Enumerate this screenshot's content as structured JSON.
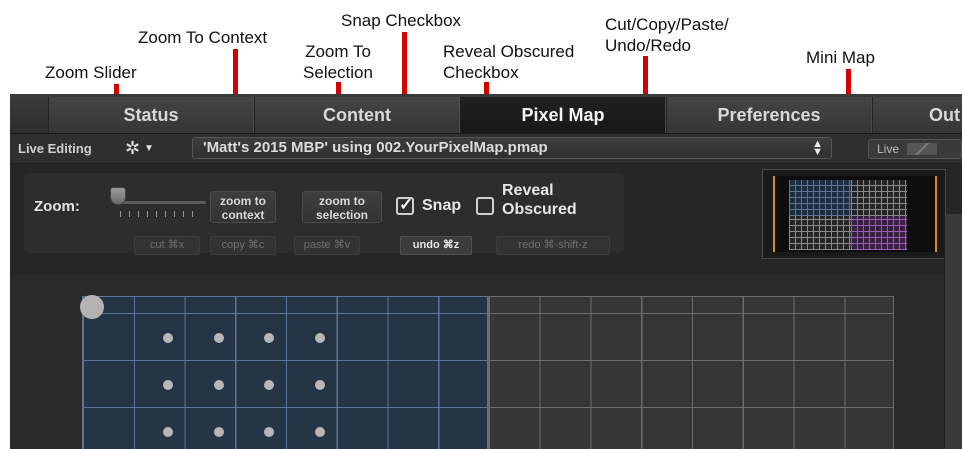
{
  "annotations": {
    "zoom_slider": "Zoom Slider",
    "zoom_to_context": "Zoom To Context",
    "zoom_to_selection_1": "Zoom To",
    "zoom_to_selection_2": "Selection",
    "snap_checkbox": "Snap Checkbox",
    "reveal_obscured_1": "Reveal Obscured",
    "reveal_obscured_2": "Checkbox",
    "cut_copy_paste_1": "Cut/Copy/Paste/",
    "cut_copy_paste_2": "Undo/Redo",
    "mini_map": "Mini Map"
  },
  "colors": {
    "annotation_line": "#d40000",
    "minimap_view": "#d98a1e"
  },
  "tabs": [
    {
      "label": "Status",
      "active": false
    },
    {
      "label": "Content",
      "active": false
    },
    {
      "label": "Pixel Map",
      "active": true
    },
    {
      "label": "Preferences",
      "active": false
    },
    {
      "label": "Out",
      "active": false
    }
  ],
  "edit_row": {
    "live_editing": "Live Editing",
    "gear_icon": "gear-icon",
    "pixel_map_selection": "'Matt's 2015 MBP' using 002.YourPixelMap.pmap",
    "live_label": "Live"
  },
  "toolbar": {
    "zoom_label": "Zoom:",
    "zoom_to_context_1": "zoom to",
    "zoom_to_context_2": "context",
    "zoom_to_selection_1": "zoom to",
    "zoom_to_selection_2": "selection",
    "snap_label": "Snap",
    "snap_checked": true,
    "reveal_1": "Reveal",
    "reveal_2": "Obscured",
    "reveal_checked": false,
    "cut": "cut ⌘x",
    "copy": "copy ⌘c",
    "paste": "paste ⌘v",
    "undo": "undo ⌘z",
    "redo": "redo ⌘-shift-z"
  }
}
